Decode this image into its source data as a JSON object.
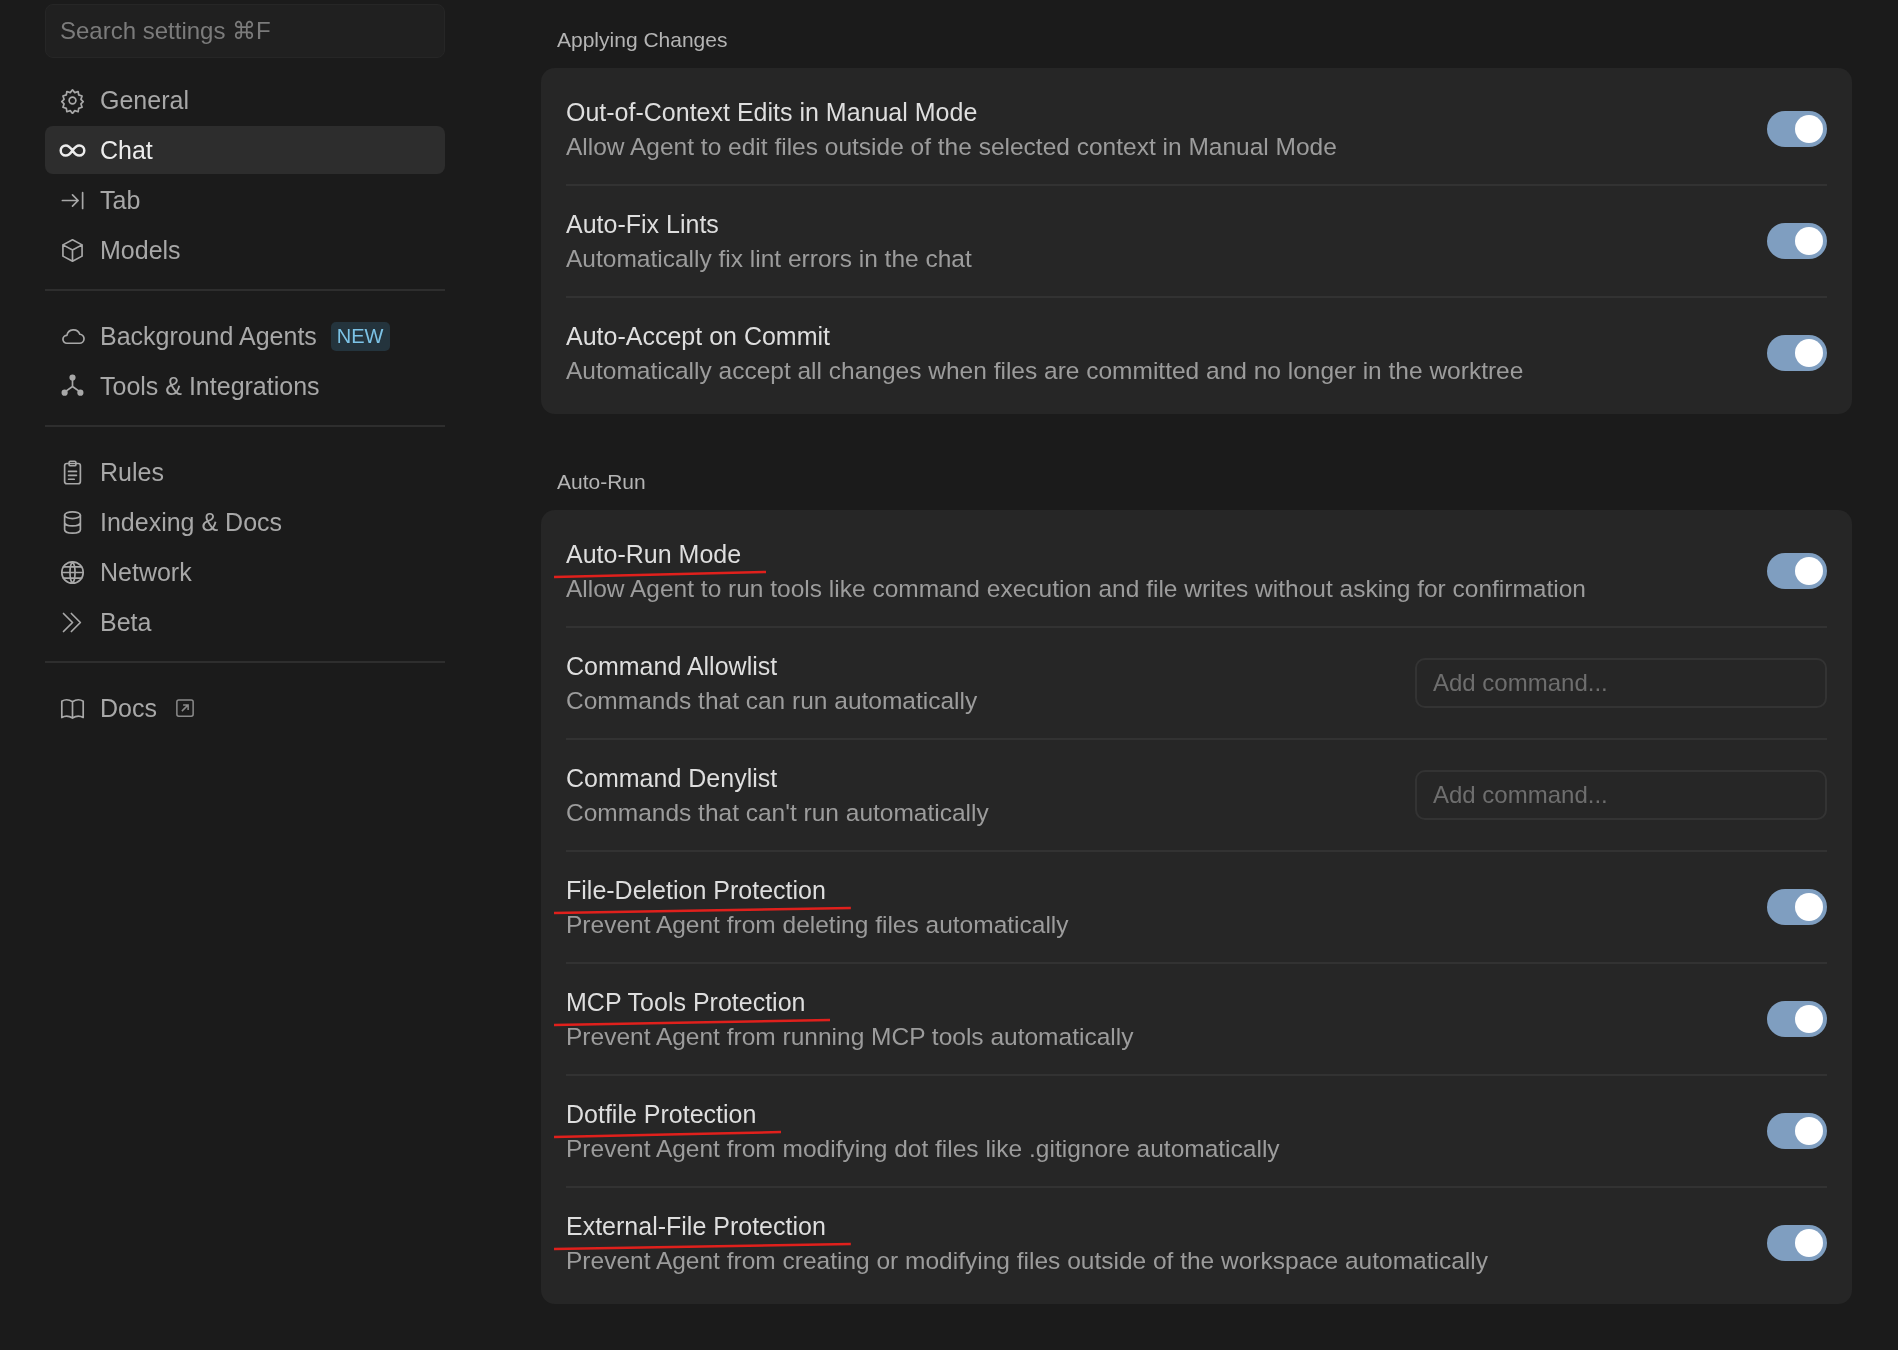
{
  "sidebar": {
    "search": {
      "placeholder": "Search settings ⌘F"
    },
    "groups": [
      {
        "items": [
          {
            "label": "General",
            "selected": false
          },
          {
            "label": "Chat",
            "selected": true
          },
          {
            "label": "Tab",
            "selected": false
          },
          {
            "label": "Models",
            "selected": false
          }
        ]
      },
      {
        "items": [
          {
            "label": "Background Agents",
            "selected": false,
            "badge": "NEW"
          },
          {
            "label": "Tools & Integrations",
            "selected": false
          }
        ]
      },
      {
        "items": [
          {
            "label": "Rules",
            "selected": false
          },
          {
            "label": "Indexing & Docs",
            "selected": false
          },
          {
            "label": "Network",
            "selected": false
          },
          {
            "label": "Beta",
            "selected": false
          }
        ]
      },
      {
        "items": [
          {
            "label": "Docs",
            "selected": false,
            "external": true
          }
        ]
      }
    ]
  },
  "sections": [
    {
      "title": "Applying Changes",
      "rows": [
        {
          "kind": "toggle",
          "title": "Out-of-Context Edits in Manual Mode",
          "description": "Allow Agent to edit files outside of the selected context in Manual Mode",
          "on": true
        },
        {
          "kind": "toggle",
          "title": "Auto-Fix Lints",
          "description": "Automatically fix lint errors in the chat",
          "on": true
        },
        {
          "kind": "toggle",
          "title": "Auto-Accept on Commit",
          "description": "Automatically accept all changes when files are committed and no longer in the worktree",
          "on": true
        }
      ]
    },
    {
      "title": "Auto-Run",
      "rows": [
        {
          "kind": "toggle",
          "title": "Auto-Run Mode",
          "description": "Allow Agent to run tools like command execution and file writes without asking for confirmation",
          "on": true,
          "underlined": true
        },
        {
          "kind": "input",
          "title": "Command Allowlist",
          "description": "Commands that can run automatically",
          "placeholder": "Add command..."
        },
        {
          "kind": "input",
          "title": "Command Denylist",
          "description": "Commands that can't run automatically",
          "placeholder": "Add command..."
        },
        {
          "kind": "toggle",
          "title": "File-Deletion Protection",
          "description": "Prevent Agent from deleting files automatically",
          "on": true,
          "underlined": true
        },
        {
          "kind": "toggle",
          "title": "MCP Tools Protection",
          "description": "Prevent Agent from running MCP tools automatically",
          "on": true,
          "underlined": true
        },
        {
          "kind": "toggle",
          "title": "Dotfile Protection",
          "description": "Prevent Agent from modifying dot files like .gitignore automatically",
          "on": true,
          "underlined": true
        },
        {
          "kind": "toggle",
          "title": "External-File Protection",
          "description": "Prevent Agent from creating or modifying files outside of the workspace automatically",
          "on": true,
          "underlined": true
        }
      ]
    }
  ]
}
